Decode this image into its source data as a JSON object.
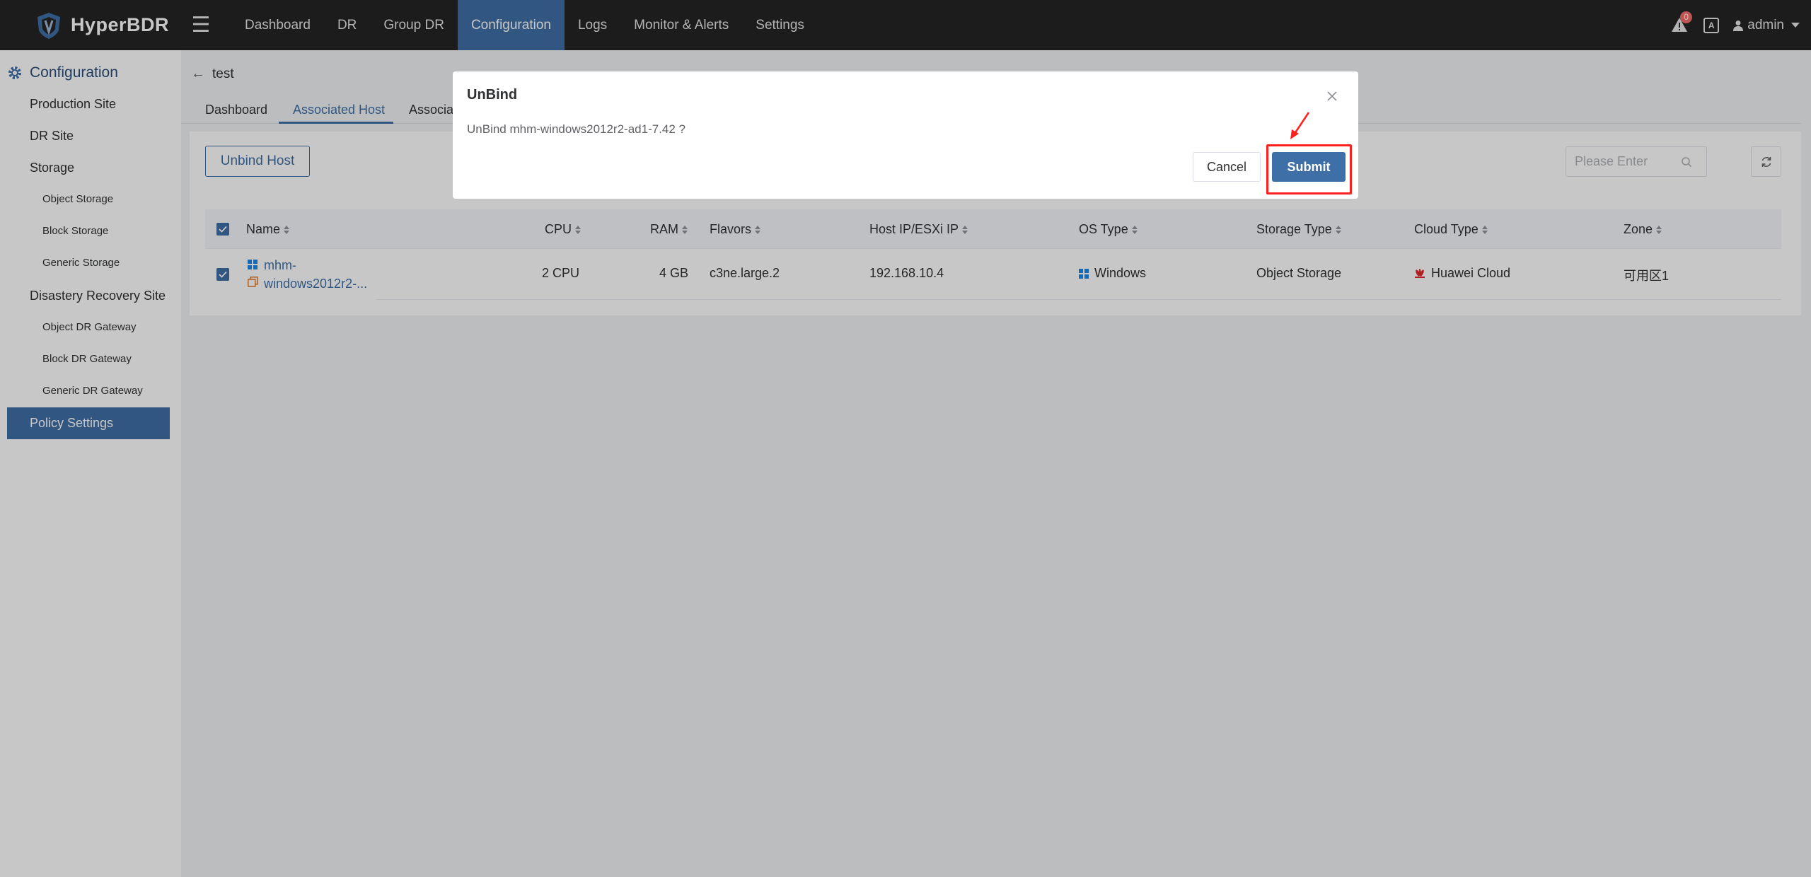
{
  "header": {
    "app_name": "HyperBDR",
    "nav": [
      "Dashboard",
      "DR",
      "Group DR",
      "Configuration",
      "Logs",
      "Monitor & Alerts",
      "Settings"
    ],
    "active_nav": "Configuration",
    "alert_count": "0",
    "user": "admin"
  },
  "sidebar": {
    "title": "Configuration",
    "items": {
      "production_site": "Production Site",
      "dr_site": "DR Site",
      "storage": "Storage",
      "object_storage": "Object Storage",
      "block_storage": "Block Storage",
      "generic_storage": "Generic Storage",
      "disaster_recovery_site": "Disastery Recovery Site",
      "object_dr_gateway": "Object DR Gateway",
      "block_dr_gateway": "Block DR Gateway",
      "generic_dr_gateway": "Generic DR Gateway",
      "policy_settings": "Policy Settings"
    }
  },
  "page": {
    "title": "test",
    "tabs": [
      "Dashboard",
      "Associated Host",
      "Associat"
    ],
    "active_tab": "Associated Host"
  },
  "toolbar": {
    "unbind_label": "Unbind Host",
    "search_placeholder": "Please Enter"
  },
  "table": {
    "columns": [
      "Name",
      "CPU",
      "RAM",
      "Flavors",
      "Host IP/ESXi IP",
      "OS Type",
      "Storage Type",
      "Cloud Type",
      "Zone"
    ],
    "rows": [
      {
        "name_line1": "mhm-",
        "name_line2": "windows2012r2-...",
        "cpu": "2 CPU",
        "ram": "4 GB",
        "flavor": "c3ne.large.2",
        "ip": "192.168.10.4",
        "os": "Windows",
        "storage": "Object Storage",
        "cloud": "Huawei Cloud",
        "zone": "可用区1"
      }
    ]
  },
  "dialog": {
    "title": "UnBind",
    "message": "UnBind mhm-windows2012r2-ad1-7.42 ?",
    "cancel": "Cancel",
    "submit": "Submit"
  },
  "colors": {
    "primary": "#3e6fa6",
    "topbar": "#242424",
    "highlight": "#ff2020",
    "huawei": "#e0272c",
    "windows": "#1e88e5"
  }
}
